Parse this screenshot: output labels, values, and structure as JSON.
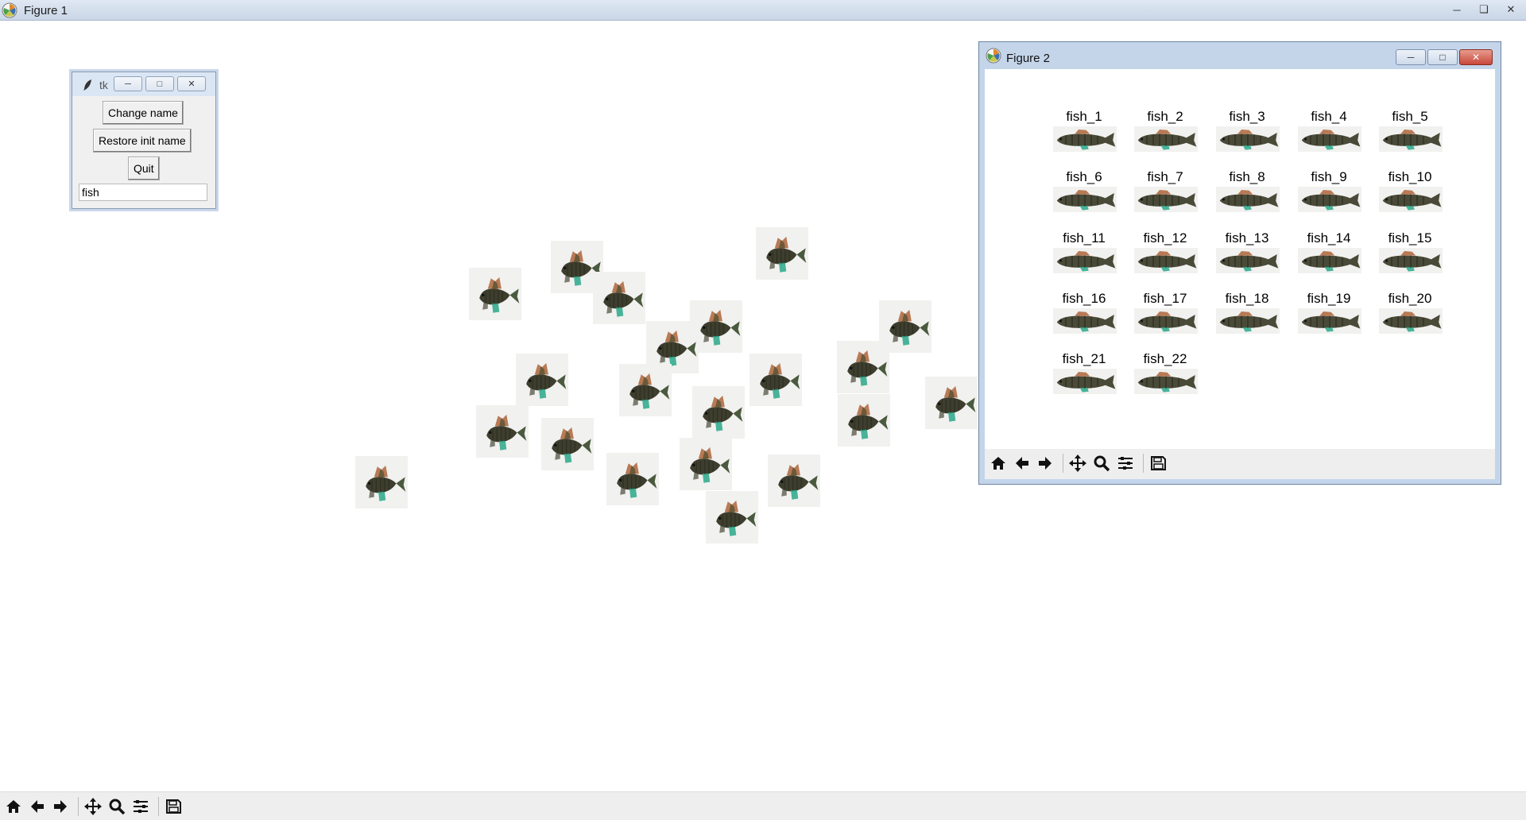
{
  "main_window": {
    "title": "Figure 1",
    "icon": "matplotlib-icon",
    "controls": [
      "minimize-icon",
      "restore-icon",
      "close-icon"
    ]
  },
  "toolbar": {
    "buttons": [
      "home-icon",
      "back-icon",
      "forward-icon",
      "pan-icon",
      "zoom-icon",
      "subplots-icon",
      "save-icon"
    ]
  },
  "tk_window": {
    "title": "tk",
    "icon": "feather-icon",
    "change_name_label": "Change name",
    "restore_label": "Restore init name",
    "quit_label": "Quit",
    "entry_value": "fish"
  },
  "figure2": {
    "title": "Figure 2",
    "labels": [
      "fish_1",
      "fish_2",
      "fish_3",
      "fish_4",
      "fish_5",
      "fish_6",
      "fish_7",
      "fish_8",
      "fish_9",
      "fish_10",
      "fish_11",
      "fish_12",
      "fish_13",
      "fish_14",
      "fish_15",
      "fish_16",
      "fish_17",
      "fish_18",
      "fish_19",
      "fish_20",
      "fish_21",
      "fish_22"
    ]
  },
  "colors": {
    "fish_body": "#3e3e2e",
    "fish_fin": "#b87a55",
    "fish_tail": "#2aa889",
    "title_bar": "#c9d6e6"
  }
}
